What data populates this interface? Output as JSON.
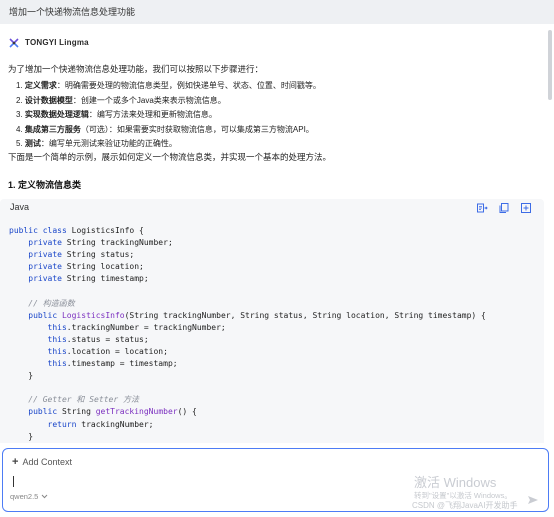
{
  "user_message": "增加一个快递物流信息处理功能",
  "assistant": {
    "name": "TONGYI Lingma",
    "intro": "为了增加一个快递物流信息处理功能，我们可以按照以下步骤进行：",
    "steps": [
      {
        "num": "1.",
        "title": "定义需求",
        "text": "：明确需要处理的物流信息类型，例如快递单号、状态、位置、时间戳等。"
      },
      {
        "num": "2.",
        "title": "设计数据模型",
        "text": "：创建一个或多个Java类来表示物流信息。"
      },
      {
        "num": "3.",
        "title": "实现数据处理逻辑",
        "text": "：编写方法来处理和更新物流信息。"
      },
      {
        "num": "4.",
        "title": "集成第三方服务",
        "text": "（可选）：如果需要实时获取物流信息，可以集成第三方物流API。"
      },
      {
        "num": "5.",
        "title": "测试",
        "text": "：编写单元测试来验证功能的正确性。"
      }
    ],
    "after_steps": "下面是一个简单的示例，展示如何定义一个物流信息类，并实现一个基本的处理方法。",
    "section_title": "1. 定义物流信息类"
  },
  "code_block": {
    "language": "Java",
    "actions": [
      "insert-icon",
      "copy-icon",
      "new-file-icon"
    ],
    "lines": [
      [
        [
          "kw",
          "public "
        ],
        [
          "kw",
          "class "
        ],
        [
          "ty",
          "LogisticsInfo {"
        ]
      ],
      [
        [
          "pl",
          "    "
        ],
        [
          "kw",
          "private "
        ],
        [
          "ty",
          "String trackingNumber;"
        ]
      ],
      [
        [
          "pl",
          "    "
        ],
        [
          "kw",
          "private "
        ],
        [
          "ty",
          "String status;"
        ]
      ],
      [
        [
          "pl",
          "    "
        ],
        [
          "kw",
          "private "
        ],
        [
          "ty",
          "String location;"
        ]
      ],
      [
        [
          "pl",
          "    "
        ],
        [
          "kw",
          "private "
        ],
        [
          "ty",
          "String timestamp;"
        ]
      ],
      [
        [
          "pl",
          ""
        ]
      ],
      [
        [
          "pl",
          "    "
        ],
        [
          "cm",
          "// 构造函数"
        ]
      ],
      [
        [
          "pl",
          "    "
        ],
        [
          "kw",
          "public "
        ],
        [
          "fn",
          "LogisticsInfo"
        ],
        [
          "pl",
          "(String trackingNumber, String status, String location, String timestamp) {"
        ]
      ],
      [
        [
          "pl",
          "        "
        ],
        [
          "kw",
          "this"
        ],
        [
          "pl",
          ".trackingNumber = trackingNumber;"
        ]
      ],
      [
        [
          "pl",
          "        "
        ],
        [
          "kw",
          "this"
        ],
        [
          "pl",
          ".status = status;"
        ]
      ],
      [
        [
          "pl",
          "        "
        ],
        [
          "kw",
          "this"
        ],
        [
          "pl",
          ".location = location;"
        ]
      ],
      [
        [
          "pl",
          "        "
        ],
        [
          "kw",
          "this"
        ],
        [
          "pl",
          ".timestamp = timestamp;"
        ]
      ],
      [
        [
          "pl",
          "    }"
        ]
      ],
      [
        [
          "pl",
          ""
        ]
      ],
      [
        [
          "pl",
          "    "
        ],
        [
          "cm",
          "// Getter 和 Setter 方法"
        ]
      ],
      [
        [
          "pl",
          "    "
        ],
        [
          "kw",
          "public "
        ],
        [
          "ty",
          "String "
        ],
        [
          "fn",
          "getTrackingNumber"
        ],
        [
          "pl",
          "() {"
        ]
      ],
      [
        [
          "pl",
          "        "
        ],
        [
          "kw",
          "return "
        ],
        [
          "pl",
          "trackingNumber;"
        ]
      ],
      [
        [
          "pl",
          "    }"
        ]
      ]
    ]
  },
  "input": {
    "add_context_label": "Add Context",
    "value": "",
    "model": "qwen2.5"
  },
  "watermark": {
    "title": "激活 Windows",
    "subtitle": "转到\"设置\"以激活 Windows。",
    "csdn": "CSDN @飞翔JavaAI开发助手"
  },
  "colors": {
    "accent": "#4d7cf5",
    "keyword": "#1a46c9",
    "function": "#7b2fbf",
    "comment": "#8a8f99",
    "code_bg": "#f6f7f9"
  }
}
